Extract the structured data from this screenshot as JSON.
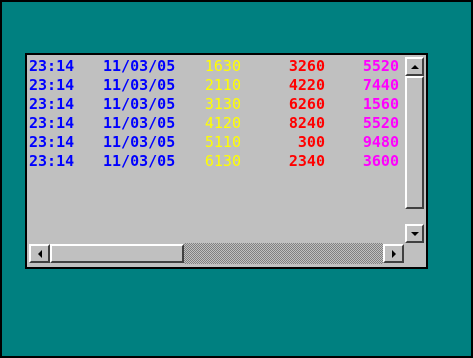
{
  "colors": {
    "background": "#008080",
    "listbox": "#c0c0c0",
    "time_date": "#0000ff",
    "value1": "#ffff00",
    "value2": "#ff0000",
    "value3": "#ff00ff"
  },
  "list": {
    "rows": [
      {
        "time": "23:14",
        "date": "11/03/05",
        "v1": "1630",
        "v2": "3260",
        "v3": "5520"
      },
      {
        "time": "23:14",
        "date": "11/03/05",
        "v1": "2110",
        "v2": "4220",
        "v3": "7440"
      },
      {
        "time": "23:14",
        "date": "11/03/05",
        "v1": "3130",
        "v2": "6260",
        "v3": "1560"
      },
      {
        "time": "23:14",
        "date": "11/03/05",
        "v1": "4120",
        "v2": "8240",
        "v3": "5520"
      },
      {
        "time": "23:14",
        "date": "11/03/05",
        "v1": "5110",
        "v2": "300",
        "v3": "9480"
      },
      {
        "time": "23:14",
        "date": "11/03/05",
        "v1": "6130",
        "v2": "2340",
        "v3": "3600"
      }
    ]
  },
  "scrollbars": {
    "vertical": {
      "up_icon": "arrow-up-icon",
      "down_icon": "arrow-down-icon"
    },
    "horizontal": {
      "left_icon": "arrow-left-icon",
      "right_icon": "arrow-right-icon"
    }
  }
}
